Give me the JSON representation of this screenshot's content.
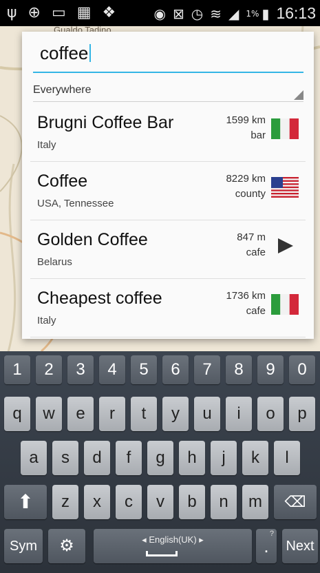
{
  "status_bar": {
    "left_icons": [
      "usb-icon",
      "target-icon",
      "battery-charge-icon",
      "storage-icon",
      "dropbox-icon"
    ],
    "right_icons": [
      "eye-icon",
      "mute-icon",
      "alarm-icon",
      "wifi-icon",
      "signal-icon"
    ],
    "battery_percent": "1%",
    "time": "16:13"
  },
  "map": {
    "labels": [
      "Gualdo Tadino"
    ]
  },
  "search": {
    "query": "coffee"
  },
  "scope": {
    "selected": "Everywhere"
  },
  "results": [
    {
      "name": "Brugni Coffee Bar",
      "location": "Italy",
      "distance": "1599 km",
      "type": "bar",
      "icon": "italy-flag-icon"
    },
    {
      "name": "Coffee",
      "location": "USA, Tennessee",
      "distance": "8229 km",
      "type": "county",
      "icon": "usa-flag-icon"
    },
    {
      "name": "Golden Coffee",
      "location": "Belarus",
      "distance": "847 m",
      "type": "cafe",
      "icon": "direction-arrow-icon"
    },
    {
      "name": "Cheapest coffee",
      "location": "Italy",
      "distance": "1736 km",
      "type": "cafe",
      "icon": "italy-flag-icon"
    }
  ],
  "keyboard": {
    "numbers": [
      "1",
      "2",
      "3",
      "4",
      "5",
      "6",
      "7",
      "8",
      "9",
      "0"
    ],
    "row1": [
      "q",
      "w",
      "e",
      "r",
      "t",
      "y",
      "u",
      "i",
      "o",
      "p"
    ],
    "row2": [
      "a",
      "s",
      "d",
      "f",
      "g",
      "h",
      "j",
      "k",
      "l"
    ],
    "row3": [
      "z",
      "x",
      "c",
      "v",
      "b",
      "n",
      "m"
    ],
    "sym_label": "Sym",
    "space_label": "English(UK)",
    "period_label": ".",
    "period_hint": "?",
    "next_label": "Next"
  }
}
